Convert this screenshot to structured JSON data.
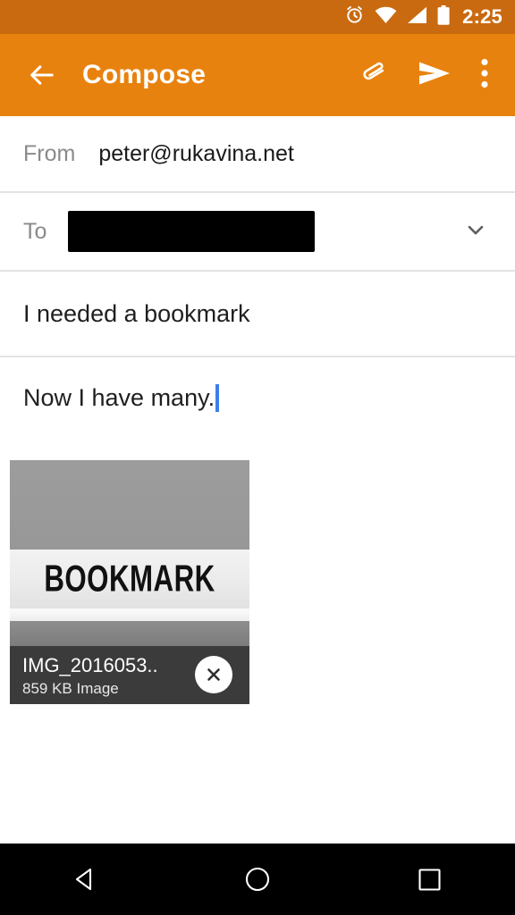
{
  "statusbar": {
    "time": "2:25",
    "icons": [
      "alarm-clock-icon",
      "wifi-icon",
      "cellular-signal-icon",
      "battery-icon"
    ]
  },
  "appbar": {
    "back_icon": "back-arrow-icon",
    "title": "Compose",
    "attach_icon": "paperclip-icon",
    "send_icon": "send-icon",
    "overflow_icon": "more-options-icon"
  },
  "compose": {
    "from": {
      "label": "From",
      "value": "peter@rukavina.net"
    },
    "to": {
      "label": "To",
      "value": "",
      "redacted": true,
      "expand_icon": "chevron-down-icon"
    },
    "subject": {
      "value": "I needed a bookmark"
    },
    "body": {
      "value": "Now I have many."
    }
  },
  "attachment": {
    "photo_text": "BOOKMARK",
    "filename": "IMG_2016053..",
    "size_label": "859 KB Image",
    "remove_icon": "close-icon"
  },
  "navbar": {
    "back": "back-triangle-icon",
    "home": "home-circle-icon",
    "recents": "recents-square-icon"
  },
  "colors": {
    "status_bar": "#c96a10",
    "app_bar": "#e8820e",
    "caret": "#3d7eeb",
    "divider": "#e3e3e3",
    "caption_bg": "#3b3b3b"
  }
}
